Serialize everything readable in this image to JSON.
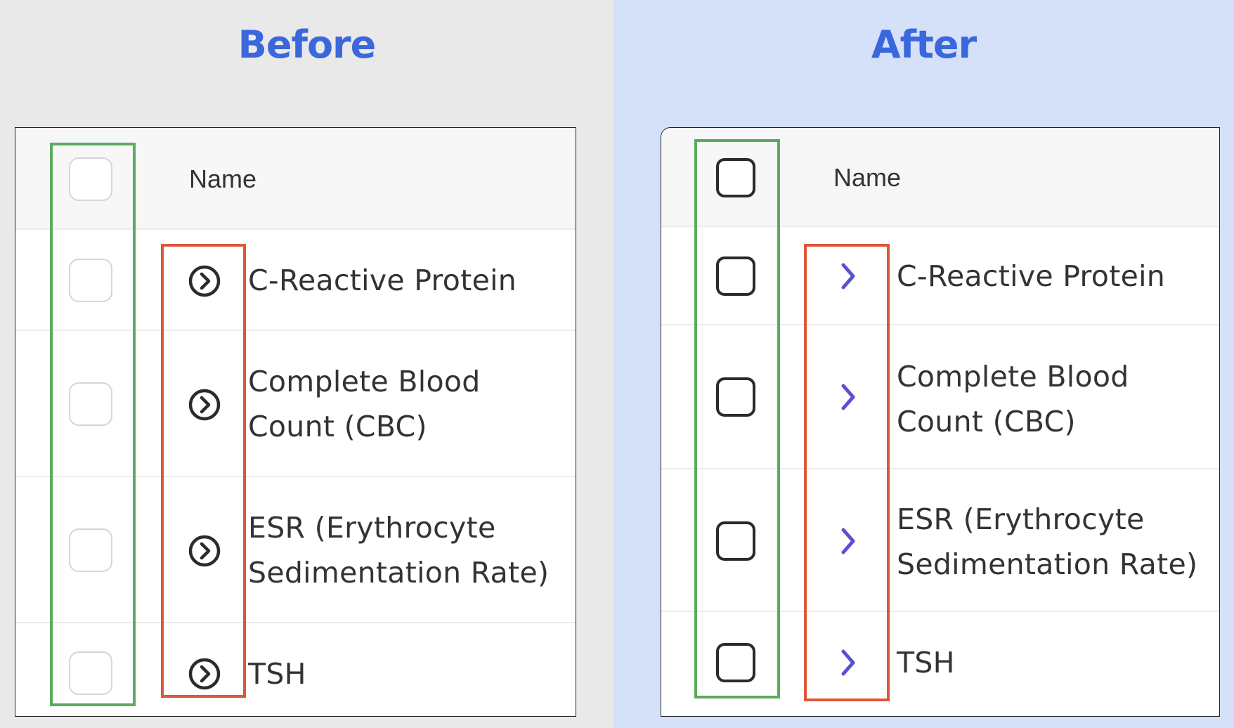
{
  "before": {
    "title": "Before",
    "header": {
      "name_label": "Name"
    },
    "rows": [
      {
        "line1": "C-Reactive Protein",
        "line2": ""
      },
      {
        "line1": "Complete Blood",
        "line2": "Count (CBC)"
      },
      {
        "line1": "ESR (Erythrocyte",
        "line2": "Sedimentation Rate)"
      },
      {
        "line1": "TSH",
        "line2": ""
      }
    ],
    "expand_icon": "circled-chevron-right-icon"
  },
  "after": {
    "title": "After",
    "header": {
      "name_label": "Name"
    },
    "rows": [
      {
        "line1": "C-Reactive Protein",
        "line2": ""
      },
      {
        "line1": "Complete Blood",
        "line2": "Count (CBC)"
      },
      {
        "line1": "ESR (Erythrocyte",
        "line2": "Sedimentation Rate)"
      },
      {
        "line1": "TSH",
        "line2": ""
      }
    ],
    "expand_icon": "chevron-right-icon"
  },
  "colors": {
    "title": "#3a68dc",
    "before_bg": "#e9e9ea",
    "after_bg": "#d5e0f9",
    "highlight_checkbox_column": "#5caa5e",
    "highlight_expand_column": "#dd563a",
    "after_chevron": "#5a4fd6",
    "before_icon": "#2b2b2b"
  }
}
